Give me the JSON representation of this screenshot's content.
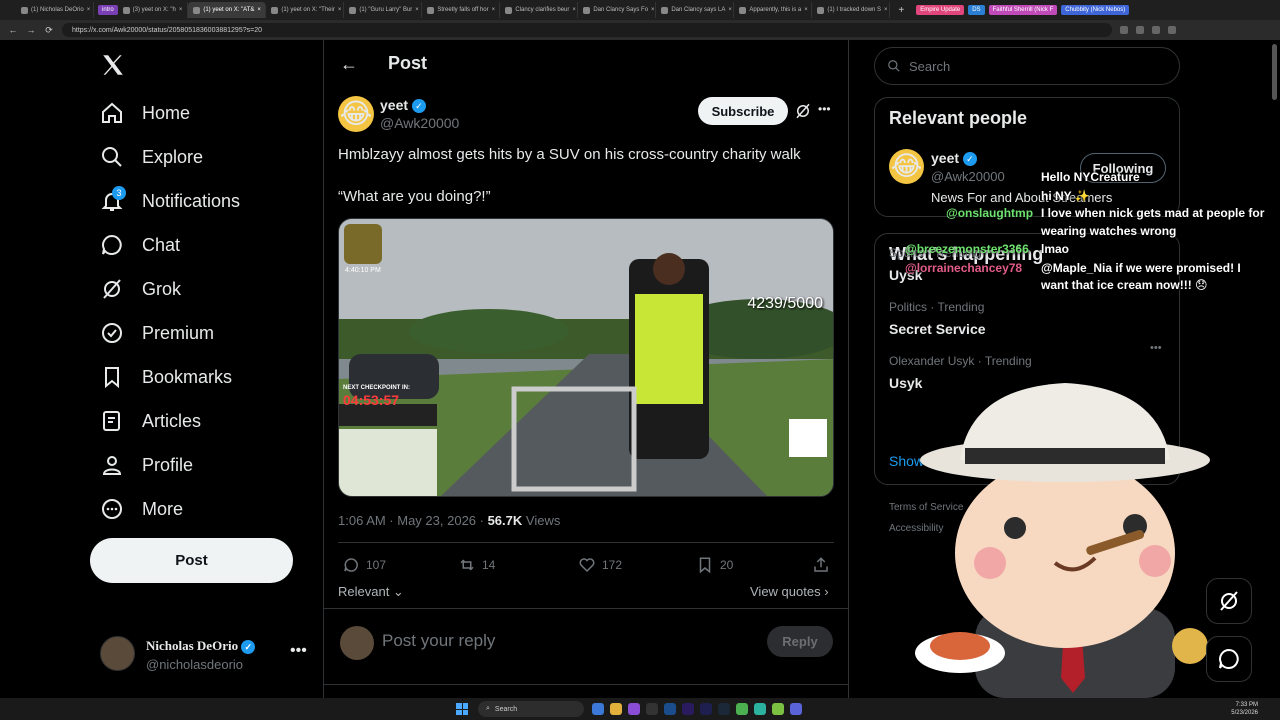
{
  "browser": {
    "tabs": [
      {
        "label": "(1) Nicholas DeOrio",
        "active": false
      },
      {
        "label": "(3) yeet on X: \"h",
        "active": false
      },
      {
        "label": "(1) yeet on X: \"AT&",
        "active": true
      },
      {
        "label": "(1) yeet on X: \"Their",
        "active": false
      },
      {
        "label": "(1) \"Guru Larry\" Bur",
        "active": false
      },
      {
        "label": "Streetly falls off hor",
        "active": false
      },
      {
        "label": "Clancy clarifies beur",
        "active": false
      },
      {
        "label": "Dan Clancy Says Fo",
        "active": false
      },
      {
        "label": "Dan Clancy says LA",
        "active": false
      },
      {
        "label": "Apparently, this is a",
        "active": false
      },
      {
        "label": "(1) I tracked down S",
        "active": false
      }
    ],
    "tab_pills": [
      {
        "label": "intro",
        "color": "#7b3fb5"
      },
      {
        "label": "Empire Update",
        "color": "#e0457b"
      },
      {
        "label": "DS",
        "color": "#2a7fd4"
      },
      {
        "label": "Faithful Sherrill (Nick F",
        "color": "#c04ab8"
      },
      {
        "label": "Chubbity (Nick Nebos)",
        "color": "#3e66d8"
      }
    ],
    "url": "https://x.com/Awk20000/status/2058051836003881295?s=20"
  },
  "sidebar": {
    "logo": "X",
    "items": [
      {
        "label": "Home",
        "icon": "home-icon"
      },
      {
        "label": "Explore",
        "icon": "search-icon"
      },
      {
        "label": "Notifications",
        "icon": "bell-icon",
        "badge": "3"
      },
      {
        "label": "Chat",
        "icon": "chat-icon"
      },
      {
        "label": "Grok",
        "icon": "grok-icon"
      },
      {
        "label": "Premium",
        "icon": "premium-icon"
      },
      {
        "label": "Bookmarks",
        "icon": "bookmark-icon"
      },
      {
        "label": "Articles",
        "icon": "articles-icon"
      },
      {
        "label": "Profile",
        "icon": "profile-icon"
      },
      {
        "label": "More",
        "icon": "more-icon"
      }
    ],
    "post_button": "Post",
    "account": {
      "name": "Nicholas DeOrio",
      "handle": "@nicholasdeorio"
    }
  },
  "post": {
    "header_title": "Post",
    "author": {
      "name": "yeet",
      "handle": "@Awk20000",
      "avatar_emoji": "😂"
    },
    "subscribe_label": "Subscribe",
    "text_line1": "Hmblzayy almost gets hits by a SUV on his cross-country charity walk",
    "text_line2": "“What are you doing?!”",
    "media": {
      "counter": "4239/5000",
      "checkpoint_label": "NEXT CHECKPOINT IN:",
      "checkpoint_timer": "04:53:57",
      "time_overlay": "4:40:10 PM"
    },
    "timestamp": "1:06 AM · May 23, 2026 · ",
    "views_count": "56.7K",
    "views_label": "Views",
    "actions": {
      "replies": "107",
      "reposts": "14",
      "likes": "172",
      "bookmarks": "20"
    },
    "sort_label": "Relevant",
    "view_quotes": "View quotes",
    "reply_placeholder": "Post your reply",
    "reply_button": "Reply"
  },
  "right": {
    "search_placeholder": "Search",
    "relevant_title": "Relevant people",
    "relevant_person": {
      "name": "yeet",
      "handle": "@Awk20000",
      "bio": "News For and About Streamers",
      "follow_label": "Following"
    },
    "happening_title": "What's happening",
    "trends": [
      {
        "context": "Sports · Trending",
        "name": "Uysk"
      },
      {
        "context": "Politics · Trending",
        "name": "Secret Service"
      },
      {
        "context": "Olexander Usyk · Trending",
        "name": "Usyk"
      }
    ],
    "show_more": "Show more",
    "footer_links": [
      "Terms of Service",
      "Accessibility"
    ]
  },
  "overlay_chat": {
    "users": [
      "@onslaughtmp",
      "@breezemonster3366",
      "@lorrainechancey78"
    ],
    "messages": [
      "Hello NYCreature",
      "hi NY ✨",
      "I love when nick gets mad at people for",
      "wearing watches wrong",
      "lmao",
      "@Maple_Nia if we were promised! I",
      "want that ice cream now!!! 😞"
    ]
  },
  "taskbar": {
    "search_label": "Search",
    "time": "7:33 PM",
    "date": "5/23/2026"
  },
  "colors": {
    "accent": "#1d9bf0",
    "background": "#000000",
    "border": "#2f3336"
  }
}
